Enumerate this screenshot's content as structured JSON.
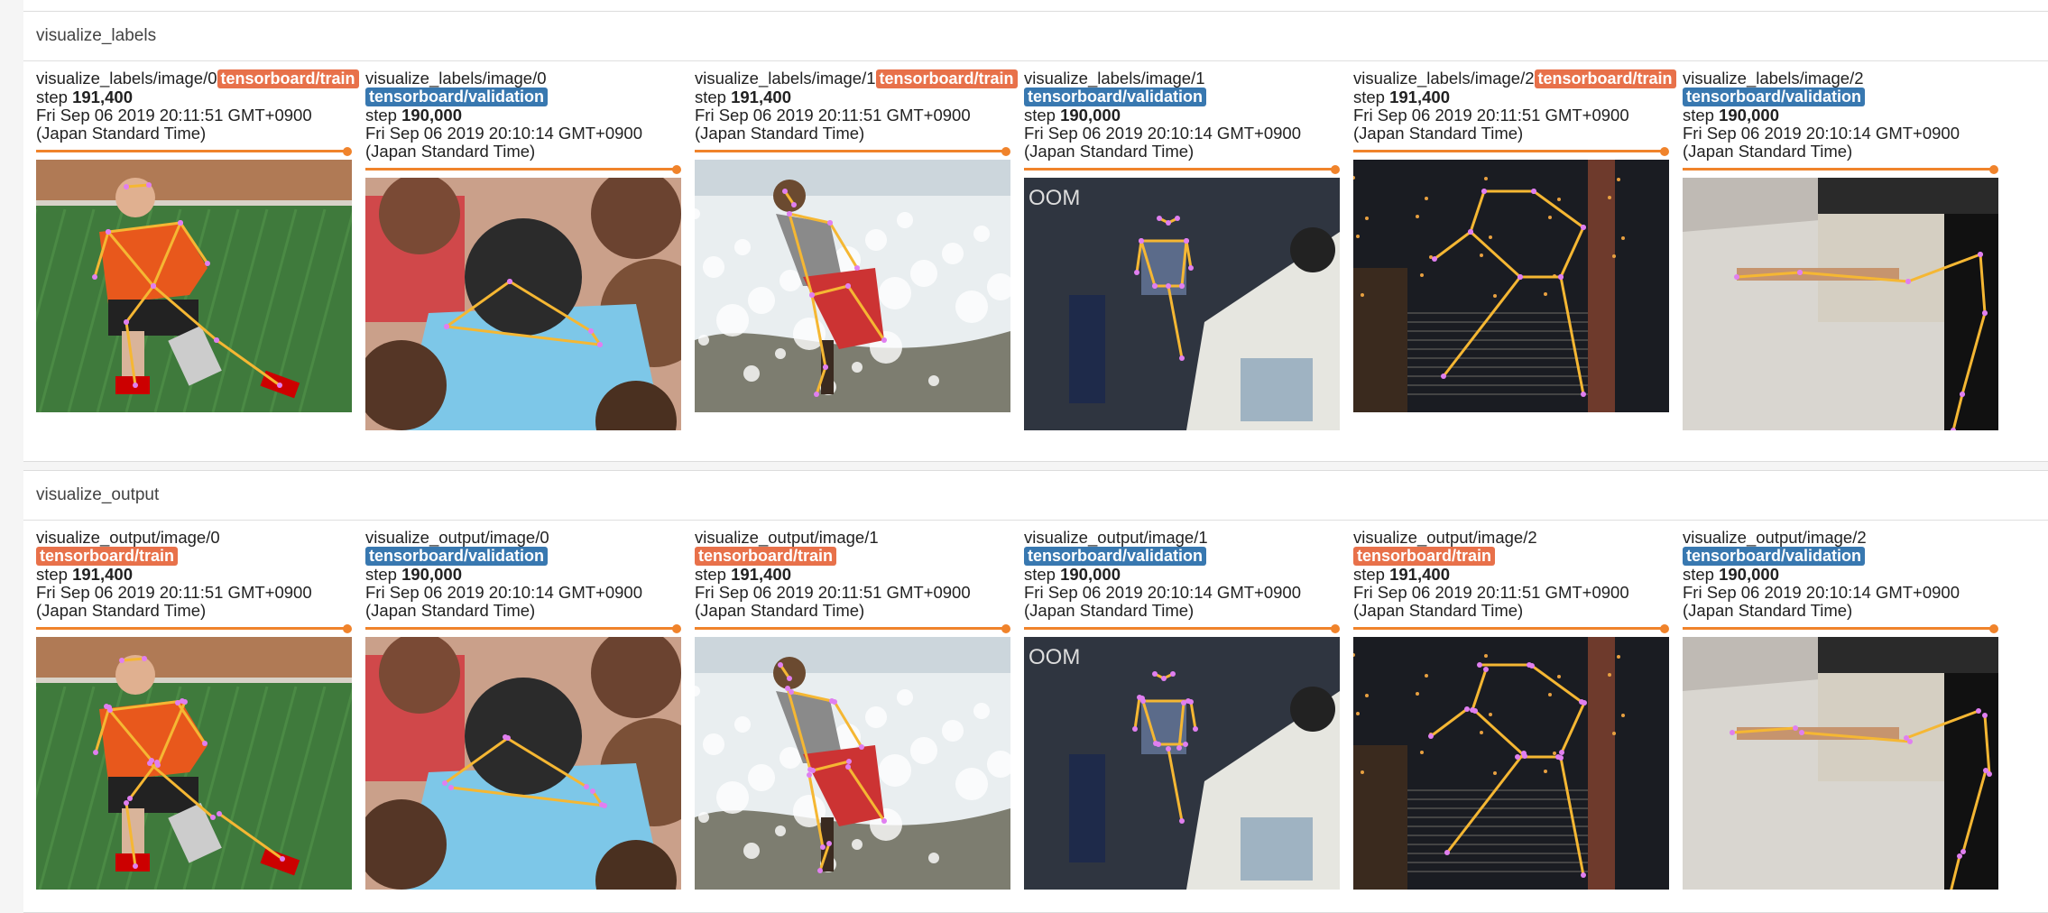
{
  "colors": {
    "train": "#e8714a",
    "validation": "#3878b0",
    "slider": "#f0832b",
    "skeleton": "#f5b733",
    "joint": "#e07ff0"
  },
  "groups": [
    {
      "title": "visualize_labels",
      "cards": [
        {
          "tag_name": "visualize_labels/image/0",
          "run": "tensorboard/train",
          "run_kind": "train",
          "step_prefix": "step ",
          "step": "191,400",
          "date": "Fri Sep 06 2019 20:11:51 GMT+0900",
          "tz": "(Japan Standard Time)",
          "scene": "soccer"
        },
        {
          "tag_name": "visualize_labels/image/0",
          "run": "tensorboard/validation",
          "run_kind": "val",
          "step_prefix": "step ",
          "step": "190,000",
          "date": "Fri Sep 06 2019 20:10:14 GMT+0900",
          "tz": "(Japan Standard Time)",
          "scene": "crowd"
        },
        {
          "tag_name": "visualize_labels/image/1",
          "run": "tensorboard/train",
          "run_kind": "train",
          "step_prefix": "step ",
          "step": "191,400",
          "date": "Fri Sep 06 2019 20:11:51 GMT+0900",
          "tz": "(Japan Standard Time)",
          "scene": "surf"
        },
        {
          "tag_name": "visualize_labels/image/1",
          "run": "tensorboard/validation",
          "run_kind": "val",
          "step_prefix": "step ",
          "step": "190,000",
          "date": "Fri Sep 06 2019 20:10:14 GMT+0900",
          "tz": "(Japan Standard Time)",
          "scene": "street"
        },
        {
          "tag_name": "visualize_labels/image/2",
          "run": "tensorboard/train",
          "run_kind": "train",
          "step_prefix": "step ",
          "step": "191,400",
          "date": "Fri Sep 06 2019 20:11:51 GMT+0900",
          "tz": "(Japan Standard Time)",
          "scene": "night"
        },
        {
          "tag_name": "visualize_labels/image/2",
          "run": "tensorboard/validation",
          "run_kind": "val",
          "step_prefix": "step ",
          "step": "190,000",
          "date": "Fri Sep 06 2019 20:10:14 GMT+0900",
          "tz": "(Japan Standard Time)",
          "scene": "concrete"
        }
      ]
    },
    {
      "title": "visualize_output",
      "cards": [
        {
          "tag_name": "visualize_output/image/0",
          "run": "tensorboard/train",
          "run_kind": "train",
          "step_prefix": "step ",
          "step": "191,400",
          "date": "Fri Sep 06 2019 20:11:51 GMT+0900",
          "tz": "(Japan Standard Time)",
          "scene": "soccer"
        },
        {
          "tag_name": "visualize_output/image/0",
          "run": "tensorboard/validation",
          "run_kind": "val",
          "step_prefix": "step ",
          "step": "190,000",
          "date": "Fri Sep 06 2019 20:10:14 GMT+0900",
          "tz": "(Japan Standard Time)",
          "scene": "crowd"
        },
        {
          "tag_name": "visualize_output/image/1",
          "run": "tensorboard/train",
          "run_kind": "train",
          "step_prefix": "step ",
          "step": "191,400",
          "date": "Fri Sep 06 2019 20:11:51 GMT+0900",
          "tz": "(Japan Standard Time)",
          "scene": "surf"
        },
        {
          "tag_name": "visualize_output/image/1",
          "run": "tensorboard/validation",
          "run_kind": "val",
          "step_prefix": "step ",
          "step": "190,000",
          "date": "Fri Sep 06 2019 20:10:14 GMT+0900",
          "tz": "(Japan Standard Time)",
          "scene": "street"
        },
        {
          "tag_name": "visualize_output/image/2",
          "run": "tensorboard/train",
          "run_kind": "train",
          "step_prefix": "step ",
          "step": "191,400",
          "date": "Fri Sep 06 2019 20:11:51 GMT+0900",
          "tz": "(Japan Standard Time)",
          "scene": "night"
        },
        {
          "tag_name": "visualize_output/image/2",
          "run": "tensorboard/validation",
          "run_kind": "val",
          "step_prefix": "step ",
          "step": "190,000",
          "date": "Fri Sep 06 2019 20:10:14 GMT+0900",
          "tz": "(Japan Standard Time)",
          "scene": "concrete"
        }
      ]
    }
  ]
}
